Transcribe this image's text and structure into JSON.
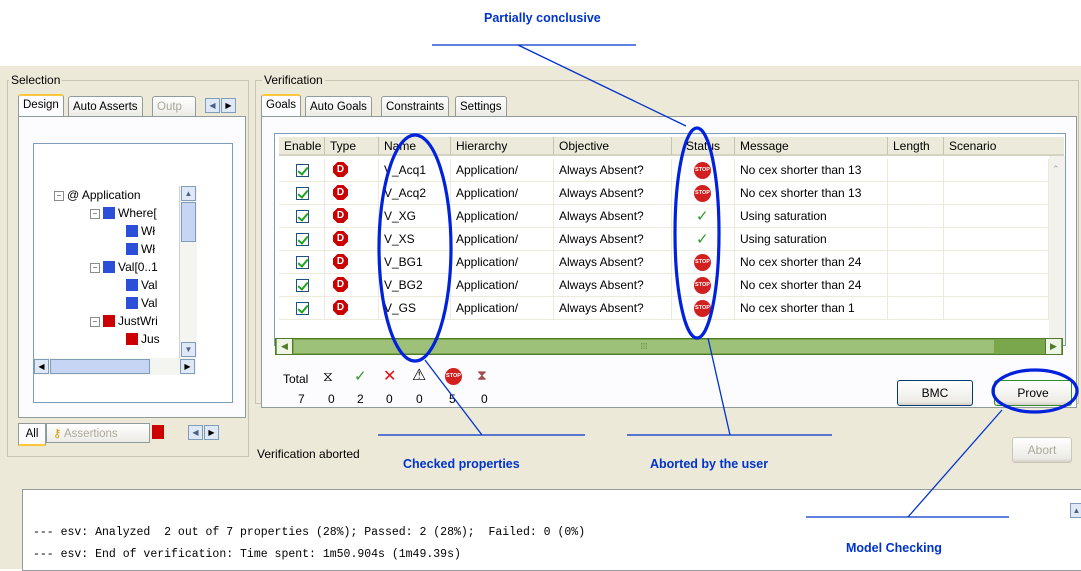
{
  "annotations": {
    "partially_conclusive": "Partially conclusive",
    "checked_properties": "Checked properties",
    "aborted_by_user": "Aborted by the user",
    "model_checking": "Model Checking"
  },
  "selection": {
    "title": "Selection",
    "tabs": [
      "Design",
      "Auto Asserts",
      "Outp"
    ],
    "tree": [
      {
        "label": "@  Application",
        "depth": 0,
        "expand": "−",
        "icon": "none"
      },
      {
        "label": "Where[",
        "depth": 1,
        "expand": "−",
        "icon": "blue"
      },
      {
        "label": "Wł",
        "depth": 2,
        "expand": "",
        "icon": "blue"
      },
      {
        "label": "Wł",
        "depth": 2,
        "expand": "",
        "icon": "blue"
      },
      {
        "label": "Val[0..1",
        "depth": 1,
        "expand": "−",
        "icon": "blue"
      },
      {
        "label": "Val",
        "depth": 2,
        "expand": "",
        "icon": "blue"
      },
      {
        "label": "Val",
        "depth": 2,
        "expand": "",
        "icon": "blue"
      },
      {
        "label": "JustWri",
        "depth": 1,
        "expand": "−",
        "icon": "red"
      },
      {
        "label": "Jus",
        "depth": 2,
        "expand": "",
        "icon": "red"
      }
    ],
    "bottom_tabs": [
      "All",
      "Assertions"
    ]
  },
  "verification": {
    "title": "Verification",
    "tabs": [
      "Goals",
      "Auto Goals",
      "Constraints",
      "Settings"
    ],
    "columns": [
      "Enable",
      "Type",
      "Name",
      "Hierarchy",
      "Objective",
      "Status",
      "Message",
      "Length",
      "Scenario"
    ],
    "rows": [
      {
        "name": "V_Acq1",
        "hierarchy": "Application/",
        "objective": "Always Absent?",
        "status": "stop",
        "message": "No cex shorter than 13"
      },
      {
        "name": "V_Acq2",
        "hierarchy": "Application/",
        "objective": "Always Absent?",
        "status": "stop",
        "message": "No cex shorter than 13"
      },
      {
        "name": "V_XG",
        "hierarchy": "Application/",
        "objective": "Always Absent?",
        "status": "ok",
        "message": "Using saturation"
      },
      {
        "name": "V_XS",
        "hierarchy": "Application/",
        "objective": "Always Absent?",
        "status": "ok",
        "message": "Using saturation"
      },
      {
        "name": "V_BG1",
        "hierarchy": "Application/",
        "objective": "Always Absent?",
        "status": "stop",
        "message": "No cex shorter than 24"
      },
      {
        "name": "V_BG2",
        "hierarchy": "Application/",
        "objective": "Always Absent?",
        "status": "stop",
        "message": "No cex shorter than 24"
      },
      {
        "name": "V_GS",
        "hierarchy": "Application/",
        "objective": "Always Absent?",
        "status": "stop",
        "message": "No cex shorter than 1"
      }
    ],
    "type_glyph": "D",
    "stop_glyph": "STOP",
    "ok_glyph": "✓",
    "summary": {
      "total_label": "Total",
      "total": "7",
      "pending": "0",
      "passed": "2",
      "failed": "0",
      "warning": "0",
      "aborted": "5",
      "cancelled": "0"
    },
    "bmc_button": "BMC",
    "prove_button": "Prove",
    "abort_button": "Abort",
    "status_text": "Verification aborted"
  },
  "log": {
    "lines": [
      "--- esv: Analyzed  2 out of 7 properties (28%); Passed: 2 (28%);  Failed: 0 (0%)",
      "--- esv: End of verification: Time spent: 1m50.904s (1m49.39s)"
    ]
  },
  "colors": {
    "annotation_blue": "#0033cc",
    "window_bg": "#ece9d8",
    "scroll_green": "#7aa64c"
  }
}
